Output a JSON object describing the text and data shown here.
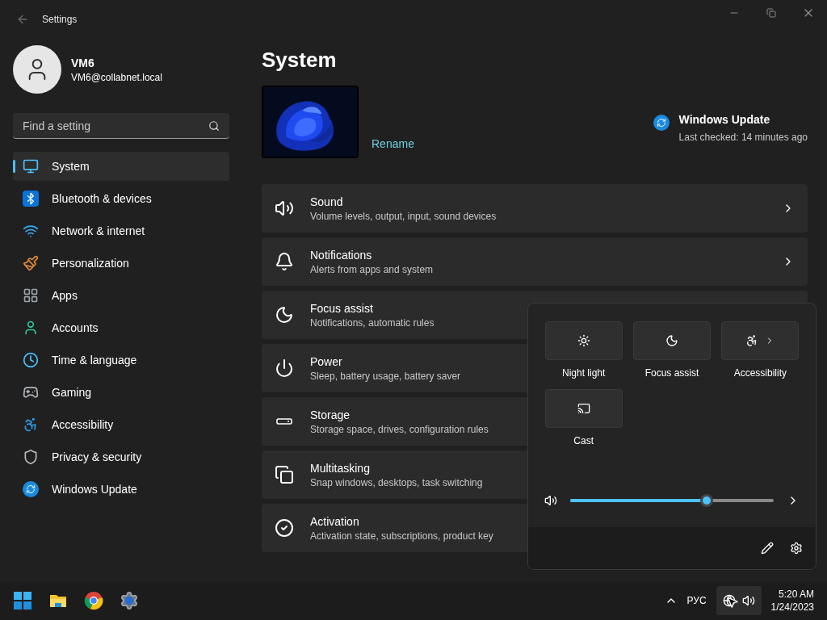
{
  "window": {
    "title": "Settings"
  },
  "account": {
    "name": "VM6",
    "email": "VM6@collabnet.local"
  },
  "search": {
    "placeholder": "Find a setting"
  },
  "sidebar": {
    "items": [
      {
        "label": "System",
        "selected": true
      },
      {
        "label": "Bluetooth & devices",
        "selected": false
      },
      {
        "label": "Network & internet",
        "selected": false
      },
      {
        "label": "Personalization",
        "selected": false
      },
      {
        "label": "Apps",
        "selected": false
      },
      {
        "label": "Accounts",
        "selected": false
      },
      {
        "label": "Time & language",
        "selected": false
      },
      {
        "label": "Gaming",
        "selected": false
      },
      {
        "label": "Accessibility",
        "selected": false
      },
      {
        "label": "Privacy & security",
        "selected": false
      },
      {
        "label": "Windows Update",
        "selected": false
      }
    ]
  },
  "page": {
    "title": "System",
    "rename": "Rename",
    "update": {
      "title": "Windows Update",
      "status": "Last checked: 14 minutes ago"
    }
  },
  "cards": [
    {
      "title": "Sound",
      "subtitle": "Volume levels, output, input, sound devices"
    },
    {
      "title": "Notifications",
      "subtitle": "Alerts from apps and system"
    },
    {
      "title": "Focus assist",
      "subtitle": "Notifications, automatic rules"
    },
    {
      "title": "Power",
      "subtitle": "Sleep, battery usage, battery saver"
    },
    {
      "title": "Storage",
      "subtitle": "Storage space, drives, configuration rules"
    },
    {
      "title": "Multitasking",
      "subtitle": "Snap windows, desktops, task switching"
    },
    {
      "title": "Activation",
      "subtitle": "Activation state, subscriptions, product key"
    }
  ],
  "quick_settings": {
    "tiles": [
      {
        "label": "Night light",
        "on": false
      },
      {
        "label": "Focus assist",
        "on": false
      },
      {
        "label": "Accessibility",
        "on": false
      },
      {
        "label": "Cast",
        "on": false
      }
    ],
    "volume": {
      "level": 0.67
    }
  },
  "taskbar": {
    "language": "РУС",
    "time": "5:20 AM",
    "date": "1/24/2023"
  }
}
